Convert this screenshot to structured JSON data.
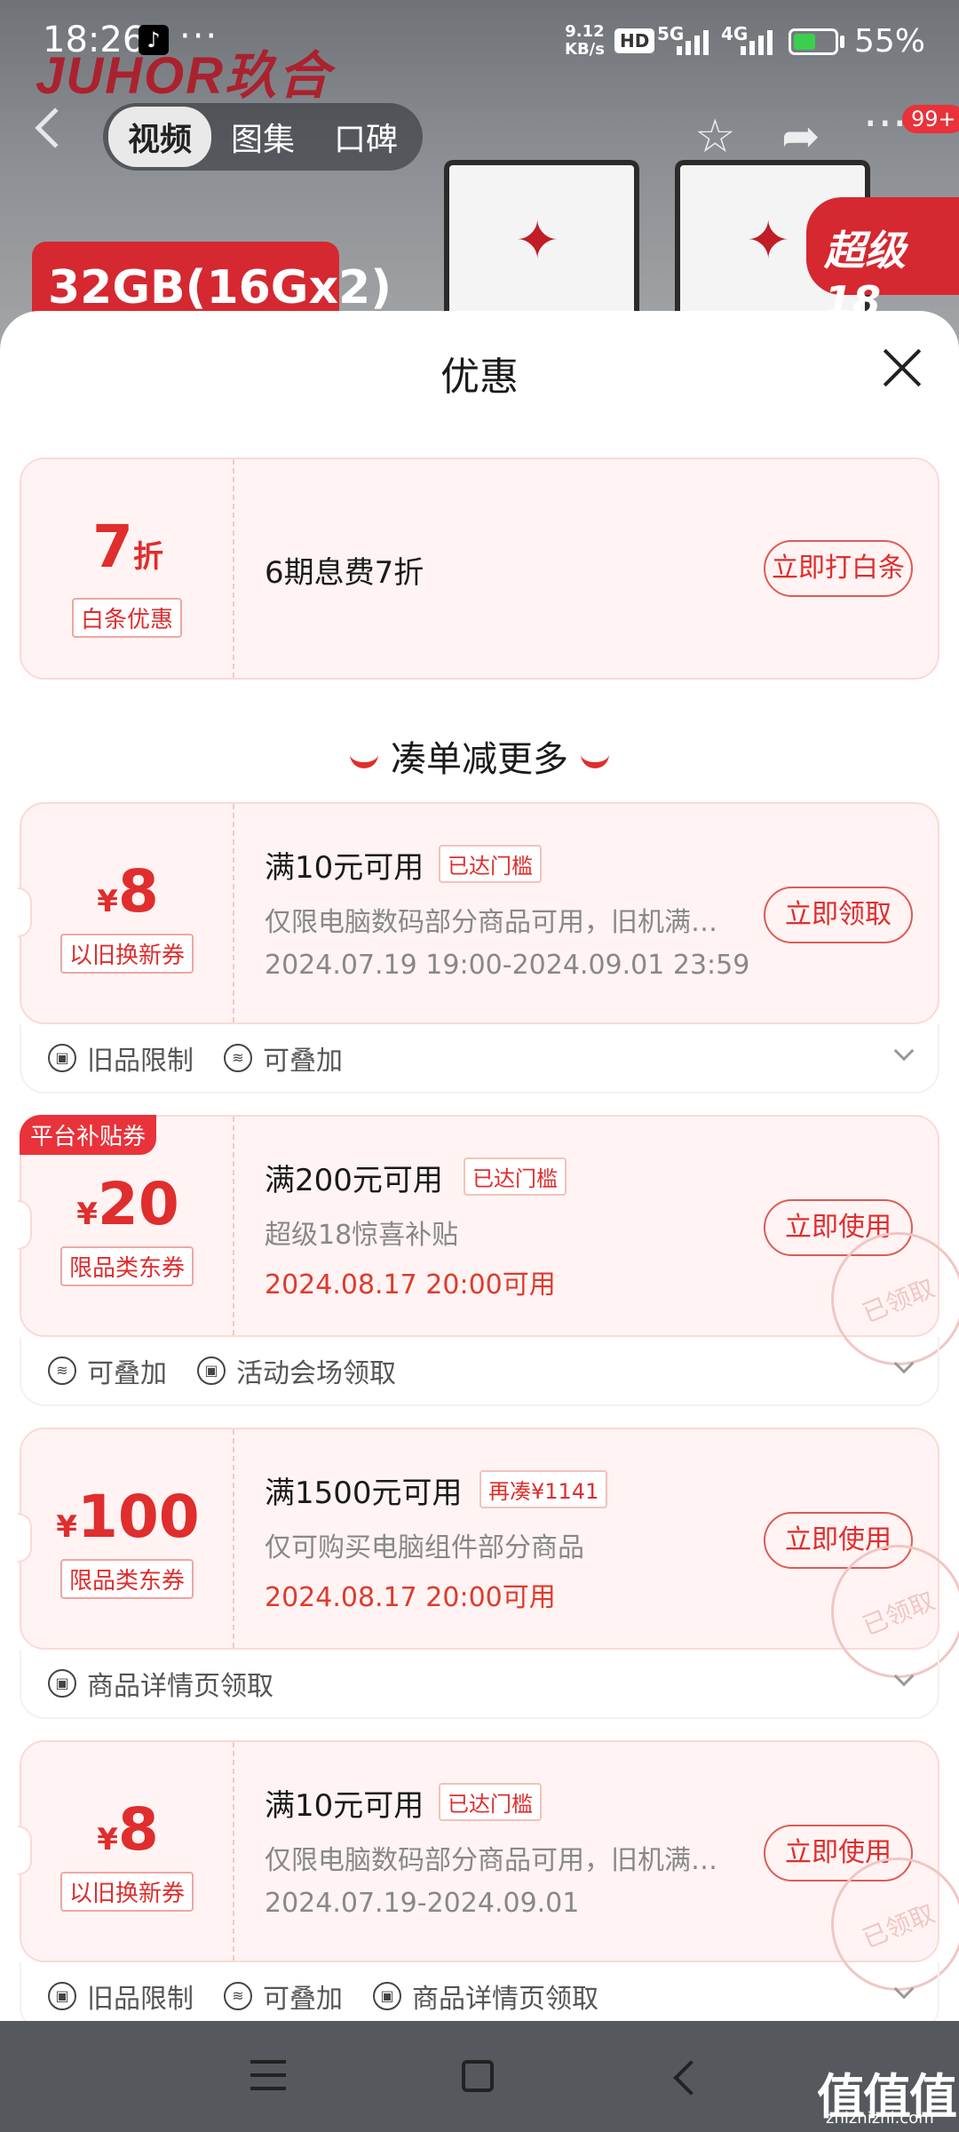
{
  "status_bar": {
    "time": "18:26",
    "net_speed": "9.12",
    "net_unit": "KB/s",
    "hd": "HD",
    "net1": "5G",
    "net2": "4G",
    "battery": "55%",
    "battery_level": 0.55
  },
  "background": {
    "brand": "JUHOR玖合",
    "tabs": [
      "视频",
      "图集",
      "口碑"
    ],
    "capacity_badge": "32GB(16Gx2)",
    "promo_badge": "超级18",
    "cart_badge": "99+"
  },
  "sheet": {
    "title": "优惠",
    "baitiao": {
      "value": "7",
      "unit": "折",
      "tag": "白条优惠",
      "title": "6期息费7折",
      "button": "立即打白条"
    },
    "section_title": "凑单减更多",
    "coupons": [
      {
        "currency": "¥",
        "amount": "8",
        "tag": "以旧换新券",
        "title": "满10元可用",
        "chip": "已达门槛",
        "desc": "仅限电脑数码部分商品可用，旧机满…",
        "date": "2024.07.19 19:00-2024.09.01 23:59",
        "button": "立即领取",
        "footer": [
          "旧品限制",
          "可叠加"
        ]
      },
      {
        "corner": "平台补贴券",
        "currency": "¥",
        "amount": "20",
        "tag": "限品类东券",
        "title": "满200元可用",
        "chip": "已达门槛",
        "desc": "超级18惊喜补贴",
        "date": "2024.08.17 20:00可用",
        "button": "立即使用",
        "stamp": "已领取",
        "footer": [
          "可叠加",
          "活动会场领取"
        ]
      },
      {
        "currency": "¥",
        "amount": "100",
        "tag": "限品类东券",
        "title": "满1500元可用",
        "chip": "再凑¥1141",
        "desc": "仅可购买电脑组件部分商品",
        "date": "2024.08.17 20:00可用",
        "button": "立即使用",
        "stamp": "已领取",
        "footer": [
          "商品详情页领取"
        ]
      },
      {
        "currency": "¥",
        "amount": "8",
        "tag": "以旧换新券",
        "title": "满10元可用",
        "chip": "已达门槛",
        "desc": "仅限电脑数码部分商品可用，旧机满…",
        "date": "2024.07.19-2024.09.01",
        "button": "立即使用",
        "stamp": "已领取",
        "footer": [
          "旧品限制",
          "可叠加",
          "商品详情页领取"
        ]
      }
    ]
  },
  "watermark": {
    "logo": "值值值",
    "site": "zhizhizhi.com"
  }
}
